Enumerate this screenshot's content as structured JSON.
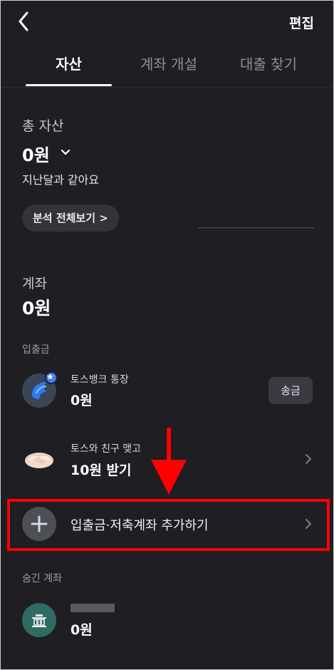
{
  "header": {
    "back_icon": "chevron-left-icon",
    "edit_label": "편집"
  },
  "tabs": [
    {
      "label": "자산",
      "active": true
    },
    {
      "label": "계좌 개설",
      "active": false
    },
    {
      "label": "대출 찾기",
      "active": false
    }
  ],
  "total": {
    "title": "총 자산",
    "amount": "0원",
    "comparison": "지난달과 같아요",
    "analysis_button": "분석 전체보기 >"
  },
  "accounts": {
    "title": "계좌",
    "amount": "0원",
    "category_label": "입출금",
    "items": [
      {
        "name": "토스뱅크 통장",
        "value": "0원",
        "action": "송금",
        "icon": "toss-bank-icon"
      },
      {
        "name": "토스와 친구 맺고",
        "value": "10원 받기",
        "icon": "handshake-icon"
      }
    ],
    "add_label": "입출금·저축계좌 추가하기"
  },
  "hidden": {
    "label": "숨긴 계좌",
    "value": "0원",
    "icon": "bank-building-icon"
  },
  "colors": {
    "background": "#1e1e23",
    "highlight": "#ff0000",
    "badge": "#3d7dff"
  }
}
